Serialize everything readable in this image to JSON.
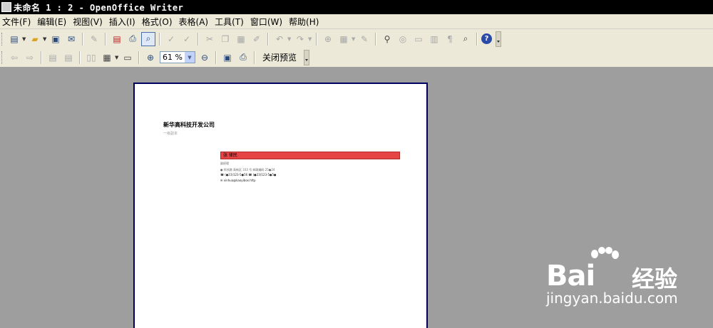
{
  "window": {
    "title": "未命名 1 : 2 - OpenOffice Writer"
  },
  "menu": [
    "文件(F)",
    "编辑(E)",
    "视图(V)",
    "插入(I)",
    "格式(O)",
    "表格(A)",
    "工具(T)",
    "窗口(W)",
    "帮助(H)"
  ],
  "preview_toolbar": {
    "zoom_value": "61 %",
    "close_label": "关闭预览"
  },
  "document": {
    "company": "新华高科技开发公司",
    "subtitle": "一级副本",
    "bar_text": "张 律民",
    "line1": "副经理",
    "line2": "● 科技路 高新区 333 号  邮政编码 25●24",
    "line3": "☎ (●23)123-5●56   ☎ (●23)123-5●5●",
    "line4": "✉ xinhua@kaoyibox.http"
  },
  "watermark": {
    "brand": "Bai",
    "brand_cn": "经验",
    "url": "jingyan.baidu.com"
  },
  "colors": {
    "background": "#9e9e9e",
    "titlebar": "#000000",
    "menubar": "#ece9d8",
    "redbar": "#e64545",
    "page_border": "#000060"
  },
  "icons": {
    "toolbar1": [
      "new-document-icon",
      "open-folder-icon",
      "save-icon",
      "email-icon",
      "edit-file-icon",
      "export-pdf-icon",
      "print-icon",
      "page-preview-icon",
      "spellcheck-icon",
      "autospell-icon",
      "cut-icon",
      "copy-icon",
      "paste-icon",
      "format-paintbrush-icon",
      "undo-icon",
      "redo-icon",
      "hyperlink-icon",
      "table-icon",
      "draw-icon",
      "find-replace-icon",
      "navigator-icon",
      "gallery-icon",
      "data-sources-icon",
      "formatting-marks-icon",
      "zoom-icon",
      "help-icon"
    ],
    "toolbar2": [
      "previous-page-icon",
      "next-page-icon",
      "first-page-icon",
      "last-page-icon",
      "two-pages-icon",
      "multiple-pages-icon",
      "book-preview-icon",
      "zoom-in-icon",
      "zoom-out-icon",
      "full-screen-icon",
      "print-preview-icon"
    ]
  }
}
